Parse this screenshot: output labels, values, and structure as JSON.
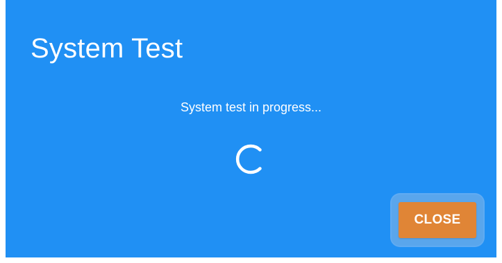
{
  "dialog": {
    "title": "System Test",
    "message": "System test in progress...",
    "spinner_icon": "loading-spinner-icon",
    "close_label": "CLOSE"
  },
  "colors": {
    "dialog_background": "#2090f4",
    "text": "#ffffff",
    "close_button": "#e08536",
    "close_focus_ring": "#5aa6ec"
  }
}
